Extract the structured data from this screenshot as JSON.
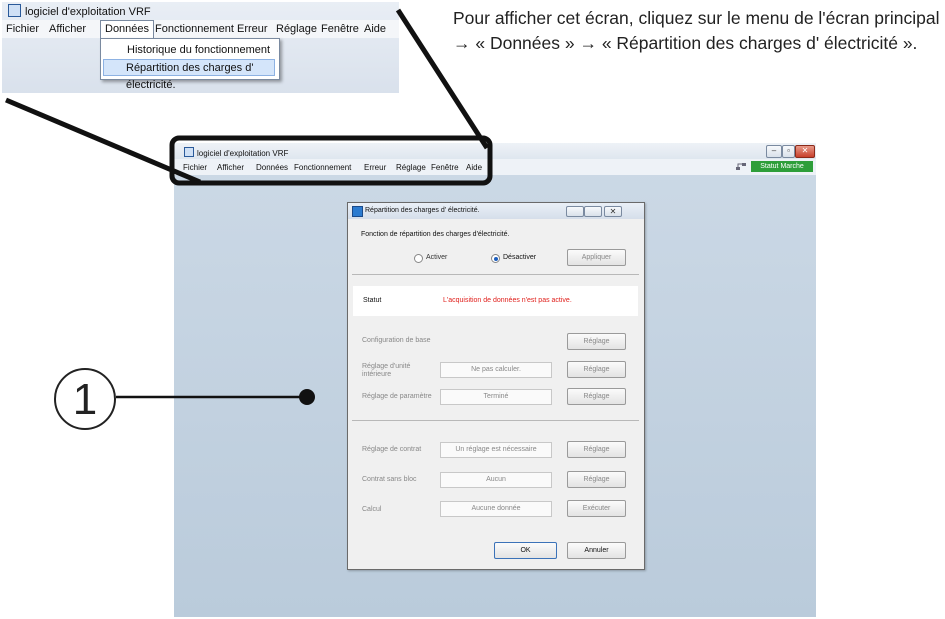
{
  "inset": {
    "title": "logiciel d'exploitation VRF",
    "menu": [
      "Fichier",
      "Afficher",
      "Données",
      "Fonctionnement",
      "Erreur",
      "Réglage",
      "Fenêtre",
      "Aide"
    ],
    "dropdown": [
      "Historique du fonctionnement",
      "Répartition des charges d' électricité."
    ]
  },
  "instruction": "Pour afficher cet écran, cliquez sur le menu de l'écran principal → « Données » → « Répartition des charges d' électricité ».",
  "app": {
    "title": "logiciel d'exploitation VRF",
    "menu": [
      "Fichier",
      "Afficher",
      "Données",
      "Fonctionnement",
      "Erreur",
      "Réglage",
      "Fenêtre",
      "Aide"
    ],
    "status_badge": "Statut Marche"
  },
  "dialog": {
    "title": "Répartition des charges d' électricité.",
    "function_label": "Fonction de répartition des charges d'électricité.",
    "radio_activate": "Activer",
    "radio_deactivate": "Désactiver",
    "selected": "Désactiver",
    "apply": "Appliquer",
    "status_label": "Statut",
    "status_message": "L'acquisition de données n'est pas active.",
    "rows": [
      {
        "label": "Configuration de base",
        "value": "",
        "button": "Réglage"
      },
      {
        "label": "Réglage d'unité intérieure",
        "value": "Ne pas calculer.",
        "button": "Réglage"
      },
      {
        "label": "Réglage de paramètre",
        "value": "Terminé",
        "button": "Réglage"
      },
      {
        "label": "Réglage de contrat",
        "value": "Un réglage est nécessaire",
        "button": "Réglage"
      },
      {
        "label": "Contrat sans bloc",
        "value": "Aucun",
        "button": "Réglage"
      },
      {
        "label": "Calcul",
        "value": "Aucune donnée",
        "button": "Exécuter"
      }
    ],
    "ok": "OK",
    "cancel": "Annuler"
  },
  "callout": "1",
  "colors": {
    "status_green": "#2e9e3a",
    "status_red": "#e0201c",
    "highlight": "#d4e5fa"
  }
}
